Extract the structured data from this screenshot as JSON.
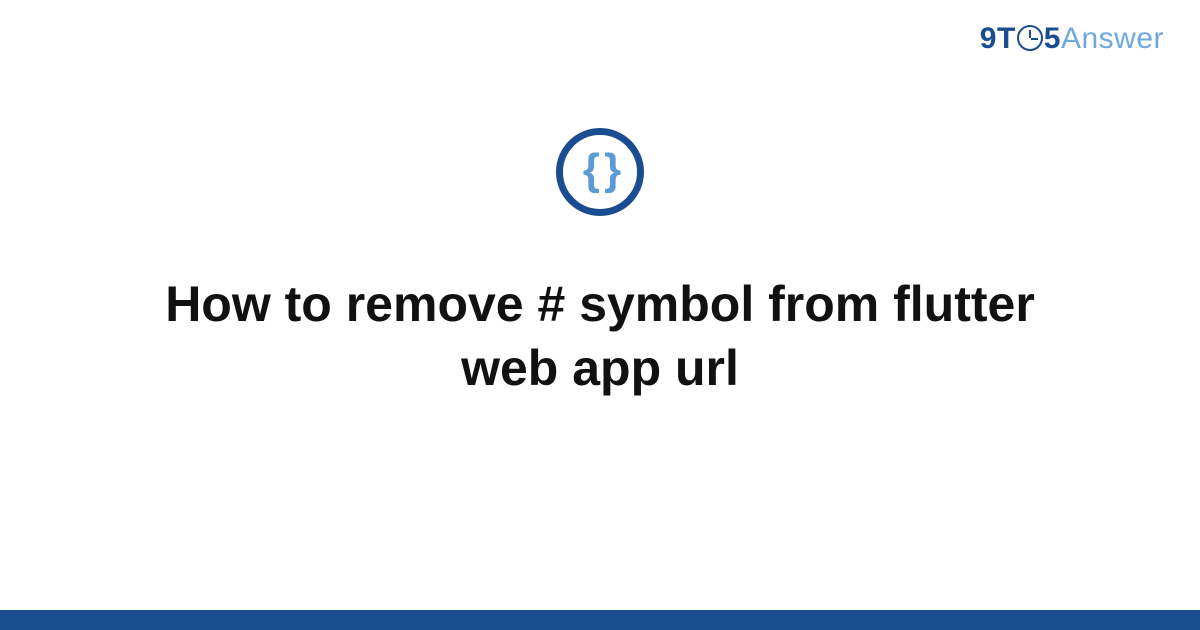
{
  "brand": {
    "part_nine": "9",
    "part_t": "T",
    "part_five": "5",
    "part_answer": "Answer"
  },
  "icon": {
    "glyph": "{ }"
  },
  "question": {
    "title": "How to remove # symbol from flutter web app url"
  },
  "colors": {
    "brand_primary": "#1a4d8f",
    "brand_accent": "#6fa8dc",
    "icon_inner": "#5b9bd5"
  }
}
